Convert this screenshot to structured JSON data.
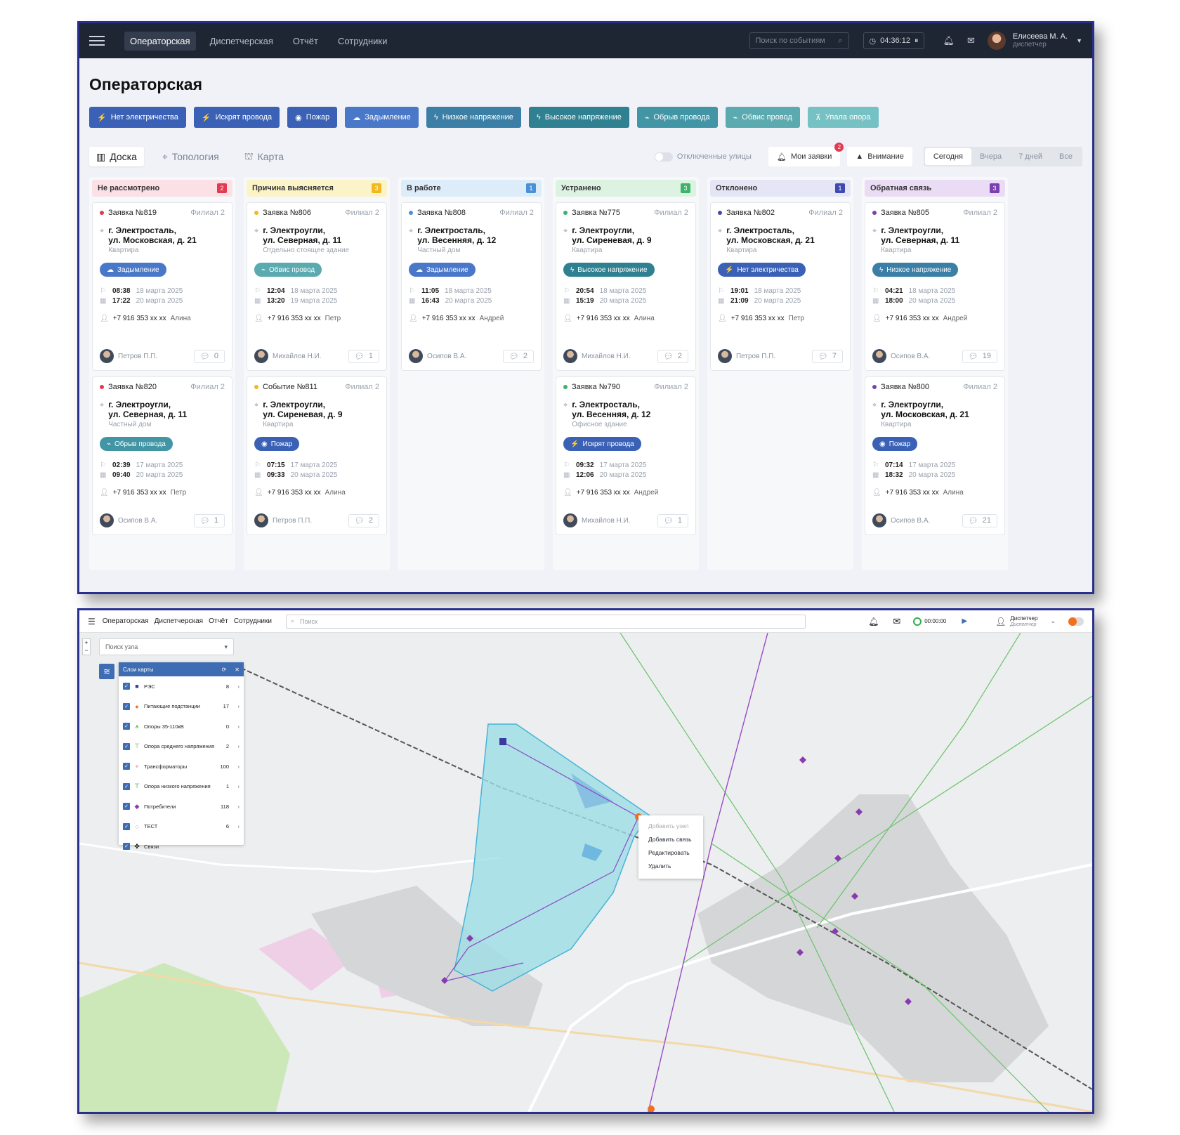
{
  "operator": {
    "nav": {
      "tabs": [
        "Операторская",
        "Диспетчерская",
        "Отчёт",
        "Сотрудники"
      ],
      "search_placeholder": "Поиск по событиям",
      "timer": "04:36:12",
      "user_name": "Елисеева М. А.",
      "user_role": "диспетчер"
    },
    "title": "Операторская",
    "event_buttons": [
      {
        "label": "Нет электричества",
        "icon": "⚡",
        "color": "#3a61b5"
      },
      {
        "label": "Искрят провода",
        "icon": "⚡",
        "color": "#3a61b5"
      },
      {
        "label": "Пожар",
        "icon": "◉",
        "color": "#3a61b5"
      },
      {
        "label": "Задымление",
        "icon": "☁",
        "color": "#4a78c8"
      },
      {
        "label": "Низкое напряжение",
        "icon": "ϟ",
        "color": "#3b7fa6"
      },
      {
        "label": "Высокое напряжение",
        "icon": "ϟ",
        "color": "#2f8090"
      },
      {
        "label": "Обрыв провода",
        "icon": "⌁",
        "color": "#4195a5"
      },
      {
        "label": "Обвис провод",
        "icon": "⌁",
        "color": "#5aaab0"
      },
      {
        "label": "Упала опора",
        "icon": "⊼",
        "color": "#76c1c4"
      }
    ],
    "view_tabs": [
      {
        "label": "Доска",
        "icon": "▥"
      },
      {
        "label": "Топология",
        "icon": "⌖"
      },
      {
        "label": "Карта",
        "icon": "⛫"
      }
    ],
    "disabled_streets_label": "Отключенные улицы",
    "my_requests": {
      "label": "Мои заявки",
      "badge": "2"
    },
    "attention_label": "Внимание",
    "periods": [
      "Сегодня",
      "Вчера",
      "7 дней",
      "Все"
    ],
    "columns": [
      {
        "title": "Не рассмотрено",
        "count": "2",
        "head_bg": "#fbe1e6",
        "count_bg": "#e53950",
        "dot": "#e53950",
        "cards": [
          {
            "id": "Заявка №819",
            "branch": "Филиал 2",
            "addr1": "г. Электросталь,",
            "addr2": "ул. Московская, д. 21",
            "type": "Квартира",
            "tag": "Задымление",
            "tag_icon": "☁",
            "tag_color": "#4a78c8",
            "t1": "08:38",
            "d1": "18 марта 2025",
            "t2": "17:22",
            "d2": "20 марта 2025",
            "phone": "+7 916 353 xx xx",
            "caller": "Алина",
            "user": "Петров П.П.",
            "comments": "0"
          },
          {
            "id": "Заявка №820",
            "branch": "Филиал 2",
            "addr1": "г. Электроугли,",
            "addr2": "ул. Северная, д. 11",
            "type": "Частный дом",
            "tag": "Обрыв провода",
            "tag_icon": "⌁",
            "tag_color": "#4195a5",
            "t1": "02:39",
            "d1": "17 марта 2025",
            "t2": "09:40",
            "d2": "20 марта 2025",
            "phone": "+7 916 353 xx xx",
            "caller": "Петр",
            "user": "Осипов В.А.",
            "comments": "1"
          }
        ]
      },
      {
        "title": "Причина выясняется",
        "count": "3",
        "head_bg": "#fcf4c9",
        "count_bg": "#f2b820",
        "dot": "#f2b820",
        "cards": [
          {
            "id": "Заявка №806",
            "branch": "Филиал 2",
            "addr1": "г. Электроугли,",
            "addr2": "ул. Северная, д. 11",
            "type": "Отдельно стоящее здание",
            "tag": "Обвис провод",
            "tag_icon": "⌁",
            "tag_color": "#5aaab0",
            "t1": "12:04",
            "d1": "18 марта 2025",
            "t2": "13:20",
            "d2": "19 марта 2025",
            "phone": "+7 916 353 xx xx",
            "caller": "Петр",
            "user": "Михайлов Н.И.",
            "comments": "1"
          },
          {
            "id": "Событие №811",
            "branch": "Филиал 2",
            "addr1": "г. Электроугли,",
            "addr2": "ул. Сиреневая, д. 9",
            "type": "Квартира",
            "tag": "Пожар",
            "tag_icon": "◉",
            "tag_color": "#3a61b5",
            "t1": "07:15",
            "d1": "17 марта 2025",
            "t2": "09:33",
            "d2": "20 марта 2025",
            "phone": "+7 916 353 xx xx",
            "caller": "Алина",
            "user": "Петров П.П.",
            "comments": "2"
          }
        ]
      },
      {
        "title": "В работе",
        "count": "1",
        "head_bg": "#dcecf8",
        "count_bg": "#4a90d9",
        "dot": "#4a90d9",
        "cards": [
          {
            "id": "Заявка №808",
            "branch": "Филиал 2",
            "addr1": "г. Электросталь,",
            "addr2": "ул. Весенняя, д. 12",
            "type": "Частный дом",
            "tag": "Задымление",
            "tag_icon": "☁",
            "tag_color": "#4a78c8",
            "t1": "11:05",
            "d1": "18 марта 2025",
            "t2": "16:43",
            "d2": "20 марта 2025",
            "phone": "+7 916 353 xx xx",
            "caller": "Андрей",
            "user": "Осипов В.А.",
            "comments": "2"
          }
        ]
      },
      {
        "title": "Устранено",
        "count": "3",
        "head_bg": "#ddf3e2",
        "count_bg": "#3bb36a",
        "dot": "#3bb36a",
        "cards": [
          {
            "id": "Заявка №775",
            "branch": "Филиал 2",
            "addr1": "г. Электроугли,",
            "addr2": "ул. Сиреневая, д. 9",
            "type": "Квартира",
            "tag": "Высокое напряжение",
            "tag_icon": "ϟ",
            "tag_color": "#2f8090",
            "t1": "20:54",
            "d1": "18 марта 2025",
            "t2": "15:19",
            "d2": "20 марта 2025",
            "phone": "+7 916 353 xx xx",
            "caller": "Алина",
            "user": "Михайлов Н.И.",
            "comments": "2"
          },
          {
            "id": "Заявка №790",
            "branch": "Филиал 2",
            "addr1": "г. Электросталь,",
            "addr2": "ул. Весенняя, д. 12",
            "type": "Офисное здание",
            "tag": "Искрят провода",
            "tag_icon": "⚡",
            "tag_color": "#3a61b5",
            "t1": "09:32",
            "d1": "17 марта 2025",
            "t2": "12:06",
            "d2": "20 марта 2025",
            "phone": "+7 916 353 xx xx",
            "caller": "Андрей",
            "user": "Михайлов Н.И.",
            "comments": "1"
          }
        ]
      },
      {
        "title": "Отклонено",
        "count": "1",
        "head_bg": "#e4e6f5",
        "count_bg": "#3f4ab0",
        "dot": "#3f4ab0",
        "cards": [
          {
            "id": "Заявка №802",
            "branch": "Филиал 2",
            "addr1": "г. Электросталь,",
            "addr2": "ул. Московская, д. 21",
            "type": "Квартира",
            "tag": "Нет электричества",
            "tag_icon": "⚡",
            "tag_color": "#3a61b5",
            "t1": "19:01",
            "d1": "18 марта 2025",
            "t2": "21:09",
            "d2": "20 марта 2025",
            "phone": "+7 916 353 xx xx",
            "caller": "Петр",
            "user": "Петров П.П.",
            "comments": "7"
          }
        ]
      },
      {
        "title": "Обратная связь",
        "count": "3",
        "head_bg": "#eadcf4",
        "count_bg": "#7a3fb0",
        "dot": "#7a3fb0",
        "cards": [
          {
            "id": "Заявка №805",
            "branch": "Филиал 2",
            "addr1": "г. Электроугли,",
            "addr2": "ул. Северная, д. 11",
            "type": "Квартира",
            "tag": "Низкое напряжение",
            "tag_icon": "ϟ",
            "tag_color": "#3b7fa6",
            "t1": "04:21",
            "d1": "18 марта 2025",
            "t2": "18:00",
            "d2": "20 марта 2025",
            "phone": "+7 916 353 xx xx",
            "caller": "Андрей",
            "user": "Осипов В.А.",
            "comments": "19"
          },
          {
            "id": "Заявка №800",
            "branch": "Филиал 2",
            "addr1": "г. Электроугли,",
            "addr2": "ул. Московская, д. 21",
            "type": "Квартира",
            "tag": "Пожар",
            "tag_icon": "◉",
            "tag_color": "#3a61b5",
            "t1": "07:14",
            "d1": "17 марта 2025",
            "t2": "18:32",
            "d2": "20 марта 2025",
            "phone": "+7 916 353 xx xx",
            "caller": "Алина",
            "user": "Осипов В.А.",
            "comments": "21"
          }
        ]
      }
    ]
  },
  "map_screen": {
    "nav": {
      "tabs": [
        "Операторская",
        "Диспетчерская",
        "Отчёт",
        "Сотрудники"
      ],
      "search_placeholder": "Поиск",
      "timer": "00:00:00",
      "user_name": "Диспетчер",
      "user_role": "Диспетчер"
    },
    "node_search_placeholder": "Поиск узла",
    "layers_title": "Слои карты",
    "layers": [
      {
        "name": "РЭС",
        "count": "8",
        "icon": "■",
        "color": "#3a3aa0"
      },
      {
        "name": "Питающие подстанции",
        "count": "17",
        "icon": "●",
        "color": "#f07020"
      },
      {
        "name": "Опоры 35-110кВ",
        "count": "0",
        "icon": "⩚",
        "color": "#3a9a3a"
      },
      {
        "name": "Опора среднего напряжения",
        "count": "2",
        "icon": "⊤",
        "color": "#5ab05a"
      },
      {
        "name": "Трансформаторы",
        "count": "100",
        "icon": "⚬",
        "color": "#e04a90"
      },
      {
        "name": "Опора низкого напряжения",
        "count": "1",
        "icon": "⊤",
        "color": "#3a8a3a"
      },
      {
        "name": "Потребители",
        "count": "118",
        "icon": "◆",
        "color": "#8a3ab0"
      },
      {
        "name": "ТЕСТ",
        "count": "6",
        "icon": "◌",
        "color": "#333333"
      },
      {
        "name": "Связи",
        "count": "",
        "icon": "✤",
        "color": "#222222"
      }
    ],
    "context_menu": [
      "Добавить узел",
      "Добавить связь",
      "Редактировать",
      "Удалить"
    ]
  }
}
